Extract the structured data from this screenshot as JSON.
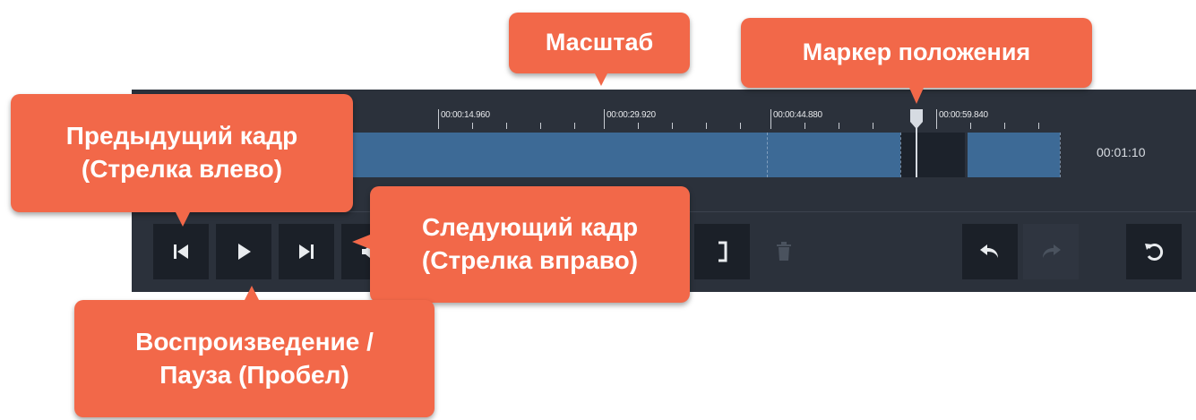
{
  "timeline": {
    "tick_labels": [
      "00:00:14.960",
      "00:00:29.920",
      "00:00:44.880",
      "00:00:59.840"
    ],
    "duration": "00:01:10"
  },
  "controls": {
    "prev_frame_icon": "skip-back-icon",
    "play_icon": "play-icon",
    "next_frame_icon": "skip-forward-icon",
    "volume_icon": "speaker-icon",
    "end_marker_icon": "right-bracket-icon",
    "delete_icon": "trash-icon",
    "undo_icon": "undo-icon",
    "redo_icon": "redo-icon",
    "reset_icon": "reset-icon"
  },
  "callouts": {
    "scale": "Масштаб",
    "position_marker": "Маркер положения",
    "prev_frame": [
      "Предыдущий кадр",
      "(Стрелка влево)"
    ],
    "next_frame": [
      "Следующий кадр",
      "(Стрелка вправо)"
    ],
    "play_pause": [
      "Воспроизведение /",
      "Пауза (Пробел)"
    ]
  },
  "colors": {
    "callout": "#f26849",
    "panel": "#2b313b",
    "button": "#1b2028",
    "track": "#3d6a96"
  }
}
